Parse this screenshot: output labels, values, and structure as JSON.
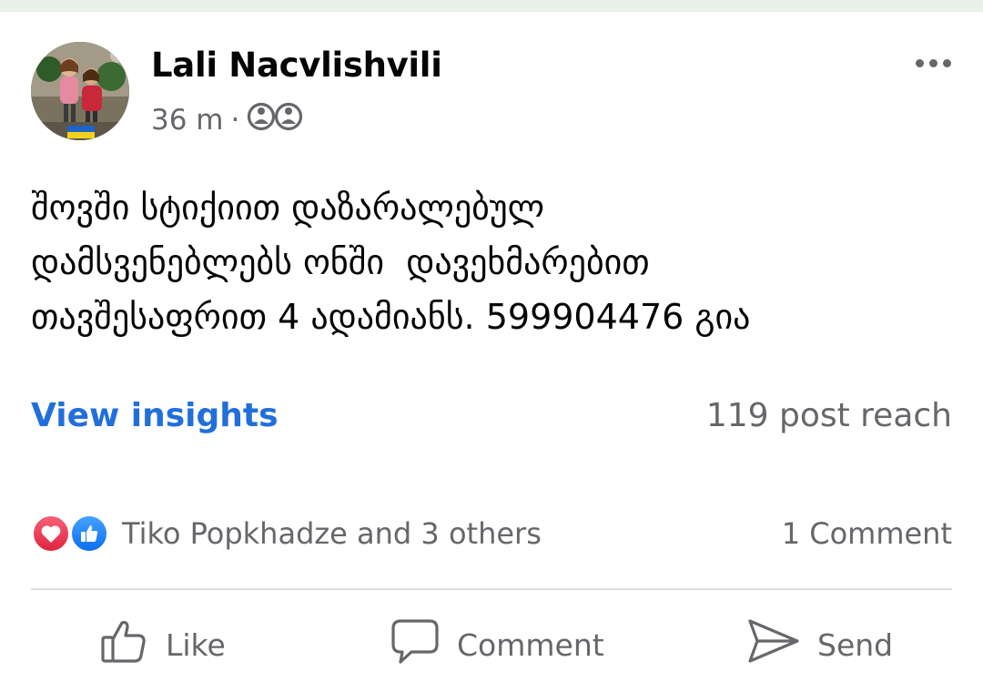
{
  "post": {
    "author": "Lali Nacvlishvili",
    "time": "36 m",
    "separator": "·",
    "audience_icon": "friends-icon",
    "text_lines": [
      "შოვში სტიქიით დაზარალებულ",
      "დამსვენებლებს ონში  დავეხმარებით",
      "თავშესაფრით 4 ადამიანს. 599904476 გია"
    ]
  },
  "insights": {
    "link_label": "View insights",
    "reach": "119 post reach"
  },
  "reactions": {
    "icons": [
      "love-reaction-icon",
      "like-reaction-icon"
    ],
    "summary": "Tiko Popkhadze and 3 others",
    "comments": "1 Comment"
  },
  "actions": {
    "like": "Like",
    "comment": "Comment",
    "send": "Send"
  },
  "colors": {
    "link": "#216fdb",
    "secondary_text": "#65676b",
    "love": "#e0243f",
    "like": "#0a6ff0",
    "divider": "#dadde1"
  }
}
